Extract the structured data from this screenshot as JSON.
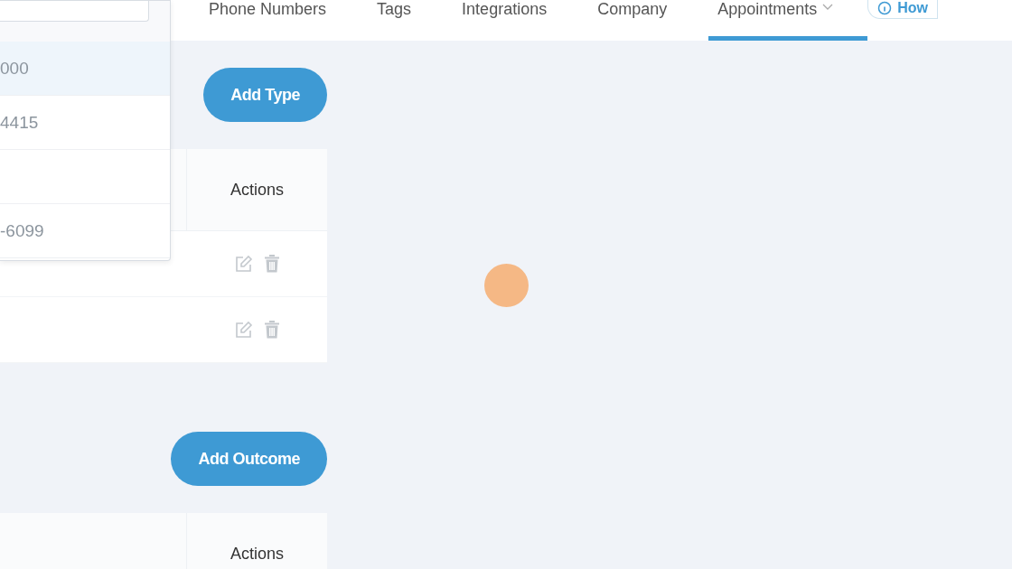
{
  "nav": {
    "tabs": [
      {
        "label": "Phone Numbers",
        "selected": false,
        "dropdown": false
      },
      {
        "label": "Tags",
        "selected": false,
        "dropdown": false
      },
      {
        "label": "Integrations",
        "selected": false,
        "dropdown": false
      },
      {
        "label": "Company",
        "selected": false,
        "dropdown": false
      },
      {
        "label": "Appointments",
        "selected": true,
        "dropdown": true
      }
    ],
    "help_button": {
      "label": "How"
    }
  },
  "dropdown": {
    "options": [
      {
        "label": "000",
        "selected": true
      },
      {
        "label": "4415",
        "selected": false
      },
      {
        "selected": false
      },
      {
        "label": "-6099",
        "selected": false
      }
    ]
  },
  "sections": [
    {
      "button": "Add Type",
      "columns": [
        "Actions"
      ],
      "rows": [
        {
          "kind": "actions"
        },
        {
          "kind": "actions"
        }
      ]
    },
    {
      "button": "Add Outcome",
      "columns": [
        "Actions"
      ]
    }
  ]
}
